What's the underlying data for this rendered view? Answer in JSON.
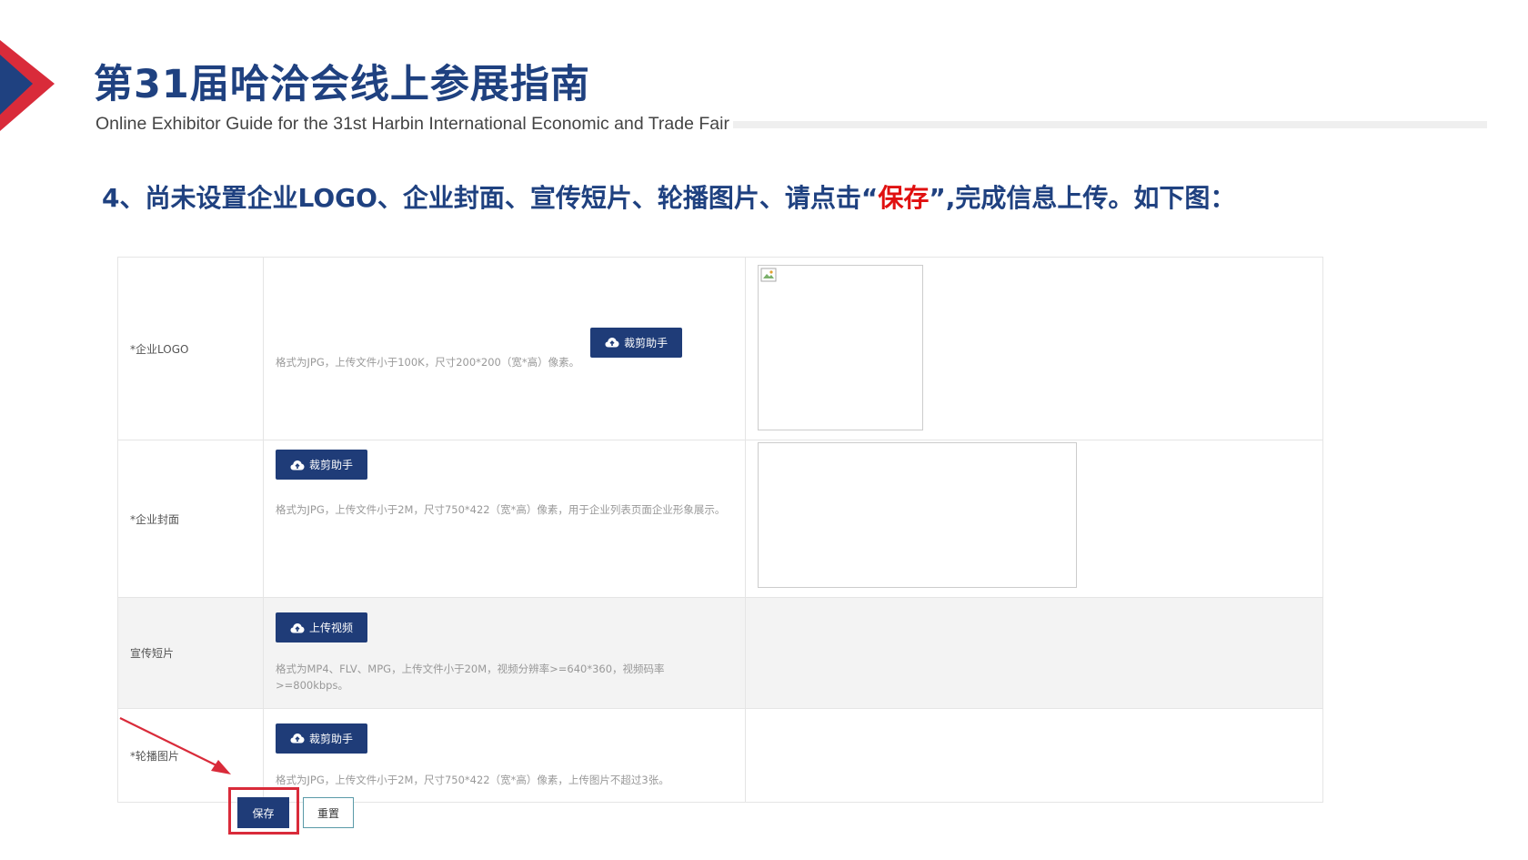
{
  "header": {
    "title_cn": "第31届哈洽会线上参展指南",
    "title_en": "Online Exhibitor Guide for the 31st Harbin International Economic and Trade Fair"
  },
  "instruction": {
    "before": "4、尚未设置企业LOGO、企业封面、宣传短片、轮播图片、请点击“",
    "highlight": "保存",
    "after": "”,完成信息上传。如下图："
  },
  "form": {
    "rows": [
      {
        "label": "*企业LOGO",
        "button": "裁剪助手",
        "hint": "格式为JPG，上传文件小于100K，尺寸200*200（宽*高）像素。"
      },
      {
        "label": "*企业封面",
        "button": "裁剪助手",
        "hint": "格式为JPG，上传文件小于2M，尺寸750*422（宽*高）像素，用于企业列表页面企业形象展示。"
      },
      {
        "label": "宣传短片",
        "button": "上传视频",
        "hint": "格式为MP4、FLV、MPG，上传文件小于20M，视频分辨率>=640*360，视频码率>=800kbps。"
      },
      {
        "label": "*轮播图片",
        "button": "裁剪助手",
        "hint": "格式为JPG，上传文件小于2M，尺寸750*422（宽*高）像素，上传图片不超过3张。"
      }
    ],
    "save_label": "保存",
    "reset_label": "重置"
  },
  "colors": {
    "brand_blue": "#1f4180",
    "button_blue": "#1f3c78",
    "highlight_red": "#e01010",
    "annotation_red": "#d92b3a"
  },
  "icons": [
    "corner-triangle-icon",
    "cloud-upload-icon",
    "broken-image-icon",
    "annotation-arrow-icon"
  ]
}
